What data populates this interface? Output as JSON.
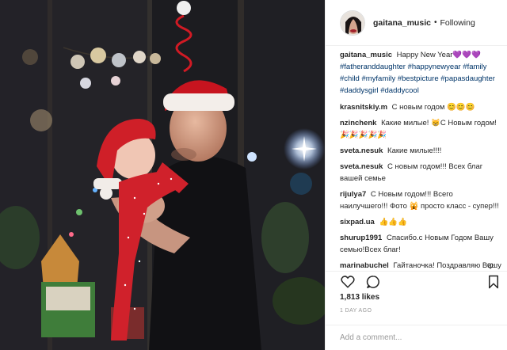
{
  "post": {
    "username": "gaitana_music",
    "separator": "•",
    "follow_status": "Following",
    "caption": {
      "text": "Happy New Year💜💜💜",
      "hashtags": "#fatheranddaughter #happynewyear #family #child #myfamily #bestpicture #papasdaughter #daddysgirl #daddycool"
    },
    "comments": [
      {
        "user": "krasnitskiy.m",
        "text": "С новым годом 😊😊😊"
      },
      {
        "user": "nzinchenk",
        "text": "Какие милые! 😸С Новым годом! 🎉🎉🎉🎉🎉"
      },
      {
        "user": "sveta.nesuk",
        "text": "Какие милые!!!!"
      },
      {
        "user": "sveta.nesuk",
        "text": "С новым годом!!! Всех благ вашей семье"
      },
      {
        "user": "rijulya7",
        "text": "С Новым годом!!! Всего наилучшего!!! Фото 🙀 просто класс - супер!!!"
      },
      {
        "user": "sixpad.ua",
        "text": "👍👍👍"
      },
      {
        "user": "shurup1991",
        "text": "Спасибо.с Новым Годом Вашу семью!Всех благ!"
      },
      {
        "user": "marinabuchel",
        "text": "Гайтаночка! Поздравляю Вашу милую семью с Новым Годом"
      }
    ],
    "likes": "1,813 likes",
    "time": "1 DAY AGO",
    "add_comment_placeholder": "Add a comment..."
  },
  "icons": {
    "like": "heart-outline-icon",
    "comment": "speech-bubble-icon",
    "save": "bookmark-icon",
    "comment_like": "small-heart-icon"
  },
  "colors": {
    "username": "#262626",
    "hashtag": "#003569",
    "muted": "#999999",
    "divider": "#efefef"
  }
}
